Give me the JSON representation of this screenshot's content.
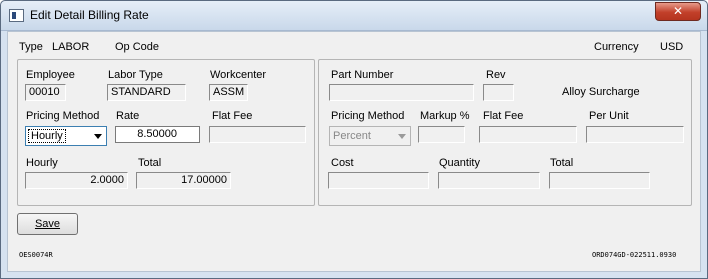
{
  "window": {
    "title": "Edit Detail Billing Rate",
    "close_label": "✕"
  },
  "header": {
    "type_label": "Type",
    "type_value": "LABOR",
    "opcode_label": "Op Code",
    "currency_label": "Currency",
    "currency_value": "USD"
  },
  "left": {
    "employee_label": "Employee",
    "employee_value": "00010",
    "labor_type_label": "Labor Type",
    "labor_type_value": "STANDARD",
    "workcenter_label": "Workcenter",
    "workcenter_value": "ASSM",
    "pricing_method_label": "Pricing Method",
    "pricing_method_value": "Hourly",
    "rate_label": "Rate",
    "rate_value": "8.50000",
    "flat_fee_label": "Flat Fee",
    "flat_fee_value": "",
    "hourly_label": "Hourly",
    "hourly_value": "2.0000",
    "total_label": "Total",
    "total_value": "17.00000"
  },
  "right": {
    "part_number_label": "Part Number",
    "part_number_value": "",
    "rev_label": "Rev",
    "rev_value": "",
    "alloy_label": "Alloy Surcharge",
    "pricing_method_label": "Pricing Method",
    "pricing_method_value": "Percent",
    "markup_label": "Markup %",
    "markup_value": "",
    "flat_fee_label": "Flat Fee",
    "flat_fee_value": "",
    "per_unit_label": "Per Unit",
    "per_unit_value": "",
    "cost_label": "Cost",
    "cost_value": "",
    "quantity_label": "Quantity",
    "quantity_value": "",
    "total_label": "Total",
    "total_value": ""
  },
  "footer": {
    "save_label": "Save",
    "form_id": "OES0074R",
    "version_id": "ORD074GD-022511.0930"
  },
  "colors": {
    "window_frame": "#d6e2f0",
    "close_button": "#c2402a",
    "client_bg": "#f0f0f0"
  },
  "icons": {
    "app": "window-app-icon",
    "close": "close-icon",
    "dropdown": "chevron-down-icon"
  }
}
